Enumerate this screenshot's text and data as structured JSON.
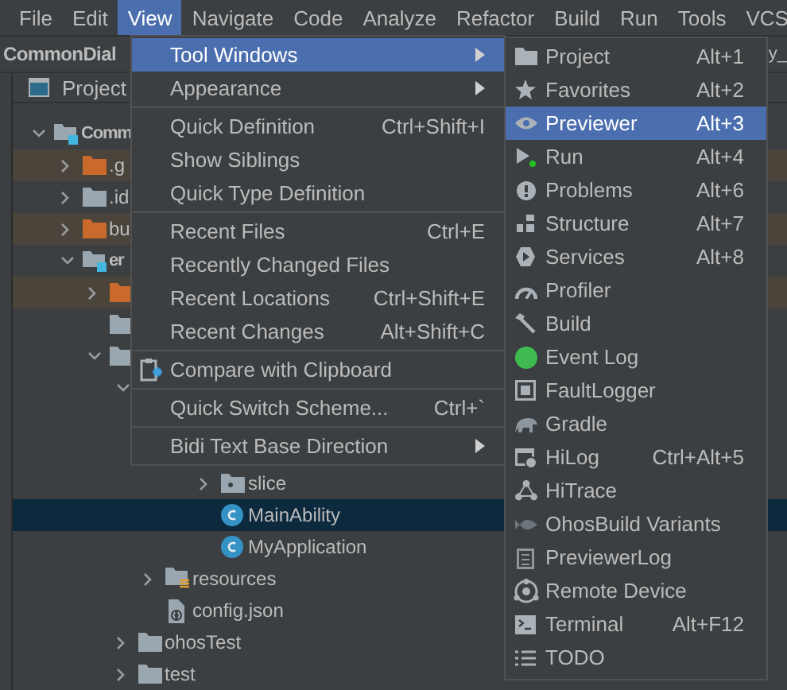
{
  "menubar": [
    {
      "label": "File",
      "selected": false
    },
    {
      "label": "Edit",
      "selected": false
    },
    {
      "label": "View",
      "selected": true
    },
    {
      "label": "Navigate",
      "selected": false
    },
    {
      "label": "Code",
      "selected": false
    },
    {
      "label": "Analyze",
      "selected": false
    },
    {
      "label": "Refactor",
      "selected": false
    },
    {
      "label": "Build",
      "selected": false
    },
    {
      "label": "Run",
      "selected": false
    },
    {
      "label": "Tools",
      "selected": false
    },
    {
      "label": "VCS",
      "selected": false
    }
  ],
  "navigation_bar": {
    "breadcrumb": "CommonDial",
    "tab_fragment": "y_"
  },
  "project_panel": {
    "title": "Project",
    "tree": [
      {
        "label": "Comm",
        "kind": "module",
        "expanded": true,
        "selected": false,
        "children": [
          {
            "label": ".g",
            "kind": "excluded",
            "expanded": false,
            "selected": false
          },
          {
            "label": ".id",
            "kind": "folder",
            "expanded": false,
            "selected": false
          },
          {
            "label": "bu",
            "kind": "excluded",
            "expanded": false,
            "selected": false
          },
          {
            "label": "er",
            "kind": "module",
            "expanded": true,
            "selected": false,
            "children": [
              {
                "kind": "excluded",
                "expanded": false,
                "selected": false
              },
              {
                "kind": "folder",
                "selected": false
              },
              {
                "kind": "folder",
                "expanded": true,
                "selected": false,
                "children": [
                  {
                    "expanded": true,
                    "selected": false,
                    "children": [
                      {
                        "selected": false,
                        "children": [
                          {
                            "expanded": true,
                            "selected": false,
                            "children": [
                              {
                                "label": "slice",
                                "kind": "package",
                                "expanded": false,
                                "selected": false
                              },
                              {
                                "label": "MainAbility",
                                "kind": "class",
                                "selected": true
                              },
                              {
                                "label": "MyApplication",
                                "kind": "class",
                                "selected": false
                              }
                            ]
                          }
                        ]
                      },
                      {
                        "label": "resources",
                        "kind": "resources",
                        "expanded": false,
                        "selected": false
                      },
                      {
                        "label": "config.json",
                        "kind": "json",
                        "selected": false
                      }
                    ]
                  },
                  {
                    "label": "ohosTest",
                    "kind": "folder",
                    "expanded": false,
                    "selected": false
                  },
                  {
                    "label": "test",
                    "kind": "folder",
                    "expanded": false,
                    "selected": false
                  }
                ]
              }
            ]
          }
        ]
      }
    ]
  },
  "view_menu": [
    {
      "kind": "item",
      "label": "Tool Windows",
      "has_submenu": true,
      "selected": true
    },
    {
      "kind": "item",
      "label": "Appearance",
      "has_submenu": true,
      "selected": false
    },
    {
      "kind": "separator"
    },
    {
      "kind": "item",
      "label": "Quick Definition",
      "shortcut": "Ctrl+Shift+I",
      "selected": false
    },
    {
      "kind": "item",
      "label": "Show Siblings",
      "selected": false
    },
    {
      "kind": "item",
      "label": "Quick Type Definition",
      "selected": false
    },
    {
      "kind": "separator"
    },
    {
      "kind": "item",
      "label": "Recent Files",
      "shortcut": "Ctrl+E",
      "selected": false
    },
    {
      "kind": "item",
      "label": "Recently Changed Files",
      "selected": false
    },
    {
      "kind": "item",
      "label": "Recent Locations",
      "shortcut": "Ctrl+Shift+E",
      "selected": false
    },
    {
      "kind": "item",
      "label": "Recent Changes",
      "shortcut": "Alt+Shift+C",
      "selected": false
    },
    {
      "kind": "separator"
    },
    {
      "kind": "item",
      "label": "Compare with Clipboard",
      "selected": false
    },
    {
      "kind": "separator"
    },
    {
      "kind": "item",
      "label": "Quick Switch Scheme...",
      "shortcut": "Ctrl+`",
      "selected": false
    },
    {
      "kind": "separator"
    },
    {
      "kind": "item",
      "label": "Bidi Text Base Direction",
      "has_submenu": true,
      "selected": false
    }
  ],
  "tool_windows_submenu": [
    {
      "label": "Project",
      "shortcut": "Alt+1",
      "selected": false
    },
    {
      "label": "Favorites",
      "shortcut": "Alt+2",
      "selected": false
    },
    {
      "label": "Previewer",
      "shortcut": "Alt+3",
      "selected": true
    },
    {
      "label": "Run",
      "shortcut": "Alt+4",
      "selected": false
    },
    {
      "label": "Problems",
      "shortcut": "Alt+6",
      "selected": false
    },
    {
      "label": "Structure",
      "shortcut": "Alt+7",
      "selected": false
    },
    {
      "label": "Services",
      "shortcut": "Alt+8",
      "selected": false
    },
    {
      "label": "Profiler",
      "selected": false
    },
    {
      "label": "Build",
      "selected": false
    },
    {
      "label": "Event Log",
      "selected": false
    },
    {
      "label": "FaultLogger",
      "selected": false
    },
    {
      "label": "Gradle",
      "selected": false
    },
    {
      "label": "HiLog",
      "shortcut": "Ctrl+Alt+5",
      "selected": false
    },
    {
      "label": "HiTrace",
      "selected": false
    },
    {
      "label": "OhosBuild Variants",
      "selected": false
    },
    {
      "label": "PreviewerLog",
      "selected": false
    },
    {
      "label": "Remote Device",
      "selected": false
    },
    {
      "label": "Terminal",
      "shortcut": "Alt+F12",
      "selected": false
    },
    {
      "label": "TODO",
      "selected": false
    }
  ]
}
